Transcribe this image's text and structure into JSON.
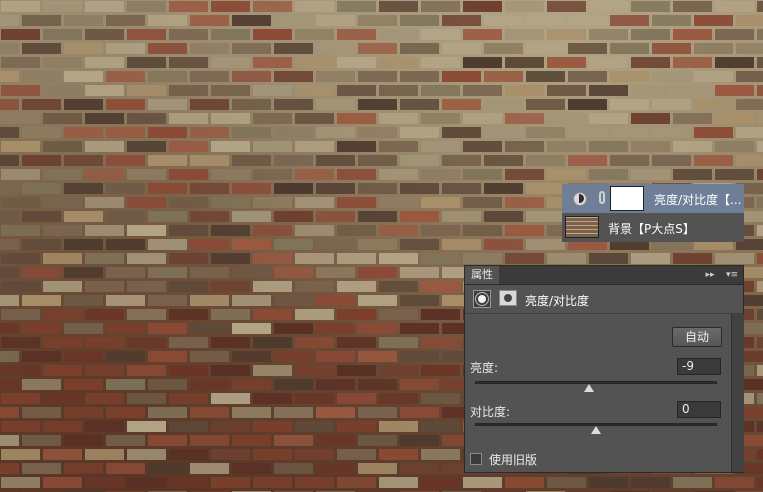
{
  "layers": {
    "items": [
      {
        "name": "亮度/对比度【...",
        "selected": true
      },
      {
        "name": "背景【P大点S】",
        "selected": false
      }
    ]
  },
  "properties": {
    "tab_label": "属性",
    "collapse_glyph": "▸▸",
    "menu_glyph": "▾≡",
    "title": "亮度/对比度",
    "auto_label": "自动",
    "brightness": {
      "label": "亮度:",
      "value": "-9",
      "level": 0.47
    },
    "contrast": {
      "label": "对比度:",
      "value": "0",
      "level": 0.5
    },
    "legacy": {
      "label": "使用旧版",
      "checked": false
    }
  },
  "colors": {
    "panel_bg": "#535353",
    "selected_layer": "#6f7f98",
    "tab_bar": "#3b3b3b"
  }
}
